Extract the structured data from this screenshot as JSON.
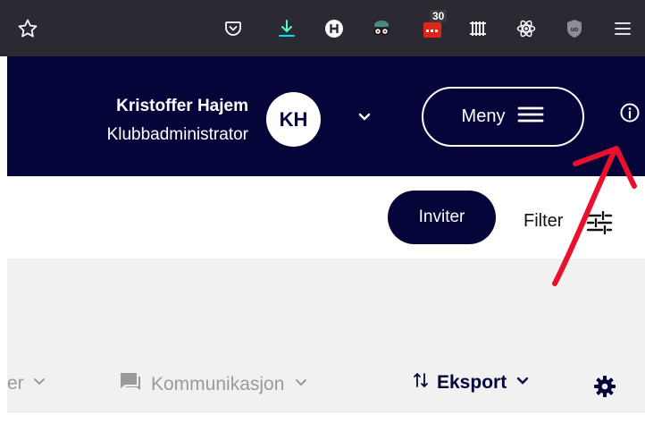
{
  "browser": {
    "toolbar_icons": [
      "star-icon",
      "pocket-icon",
      "download-icon",
      "h-extension-icon",
      "spy-extension-icon",
      "calendar-extension-icon",
      "hash-extension-icon",
      "react-devtools-icon",
      "ublock-icon",
      "hamburger-menu-icon"
    ],
    "calendar_badge": "30",
    "bg_color": "#2b2a33"
  },
  "header": {
    "user_name": "Kristoffer Hajem",
    "user_role": "Klubbadministrator",
    "avatar_initials": "KH",
    "menu_label": "Meny",
    "bg_color": "#05053a"
  },
  "toolbar": {
    "invite_label": "Inviter",
    "filter_label": "Filter"
  },
  "tabs": {
    "partial_label": "er",
    "communication_label": "Kommunikasjon",
    "export_label": "Eksport"
  },
  "annotation": {
    "arrow_color": "#e8112d"
  }
}
